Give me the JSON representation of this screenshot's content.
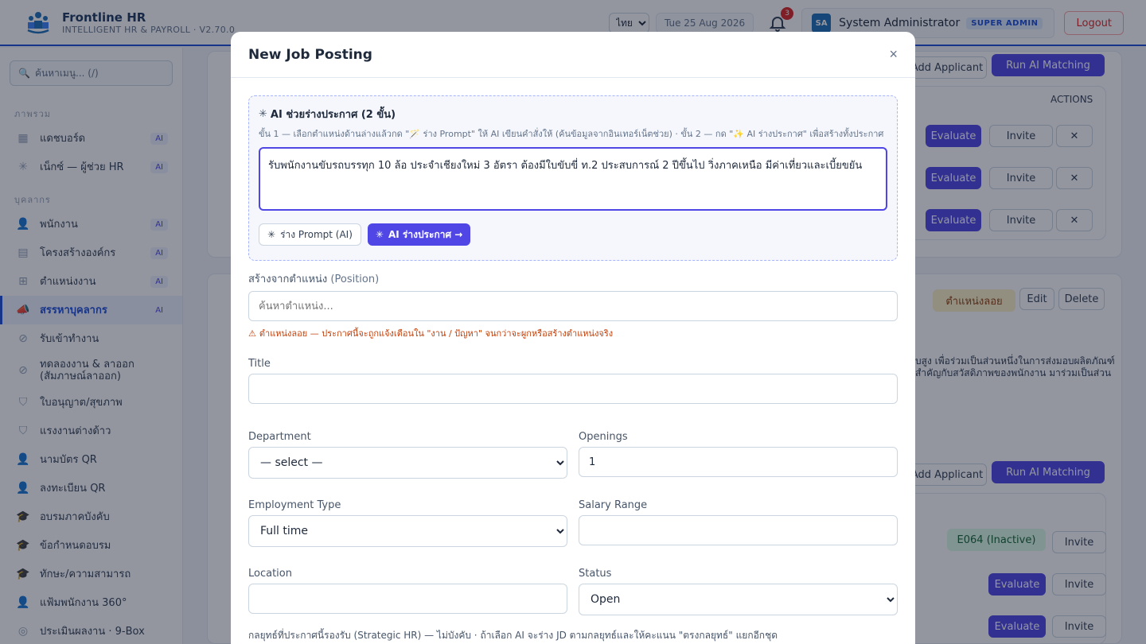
{
  "header": {
    "brand_name": "Frontline HR",
    "brand_sub": "INTELLIGENT HR & PAYROLL · V2.70.0",
    "lang": "ไทย",
    "date": "Tue 25 Aug 2026",
    "notif_count": "3",
    "avatar_initials": "SA",
    "user_name": "System Administrator",
    "role": "SUPER ADMIN",
    "logout_label": "Logout"
  },
  "sidebar": {
    "search_placeholder": "ค้นหาเมนู... (/)",
    "section_overview": "ภาพรวม",
    "section_people": "บุคลากร",
    "items": [
      {
        "label": "แดชบอร์ด",
        "icon": "dashboard-icon",
        "ai": "AI"
      },
      {
        "label": "เน็กซ์ — ผู้ช่วย HR",
        "icon": "sparkle-icon",
        "ai": "AI"
      },
      {
        "label": "พนักงาน",
        "icon": "users-icon",
        "ai": "AI"
      },
      {
        "label": "โครงสร้างองค์กร",
        "icon": "building-icon",
        "ai": "AI"
      },
      {
        "label": "ตำแหน่งงาน",
        "icon": "org-chart-icon",
        "ai": "AI"
      },
      {
        "label": "สรรหาบุคลากร",
        "icon": "megaphone-icon",
        "ai": "AI"
      },
      {
        "label": "รับเข้าทำงาน",
        "icon": "compass-icon",
        "ai": ""
      },
      {
        "label": "ทดลองงาน & ลาออก (สัมภาษณ์ลาออก)",
        "icon": "compass-icon",
        "ai": ""
      },
      {
        "label": "ใบอนุญาต/สุขภาพ",
        "icon": "shield-check-icon",
        "ai": ""
      },
      {
        "label": "แรงงานต่างด้าว",
        "icon": "shield-check-icon",
        "ai": ""
      },
      {
        "label": "นามบัตร QR",
        "icon": "user-icon",
        "ai": ""
      },
      {
        "label": "ลงทะเบียน QR",
        "icon": "user-icon",
        "ai": ""
      },
      {
        "label": "อบรมภาคบังคับ",
        "icon": "graduation-cap-icon",
        "ai": ""
      },
      {
        "label": "ข้อกำหนดอบรม",
        "icon": "graduation-cap-icon",
        "ai": ""
      },
      {
        "label": "ทักษะ/ความสามารถ",
        "icon": "graduation-cap-icon",
        "ai": ""
      },
      {
        "label": "แฟ้มพนักงาน 360°",
        "icon": "user-icon",
        "ai": ""
      },
      {
        "label": "ประเมินผลงาน · 9-Box",
        "icon": "target-icon",
        "ai": ""
      }
    ]
  },
  "background": {
    "add_applicant": "Add Applicant",
    "run_ai_matching": "Run AI Matching",
    "actions_header": "ACTIONS",
    "evaluate": "Evaluate",
    "invite": "Invite",
    "edit": "Edit",
    "delete": "Delete",
    "floating_position": "ตำแหน่งลอย",
    "inactive_badge": "E064 (Inactive)",
    "snippet_1": "บสูง เพื่อร่วมเป็นส่วนหนึ่งในการส่งมอบผลิตภัณฑ์",
    "snippet_2": "สำคัญกับสวัสดิภาพของพนักงาน มาร่วมเป็นส่วน"
  },
  "modal": {
    "title": "New Job Posting",
    "close": "×",
    "ai_box": {
      "title": "AI ช่วยร่างประกาศ (2 ขั้น)",
      "help": "ขั้น 1 — เลือกตำแหน่งด้านล่างแล้วกด \"🪄 ร่าง Prompt\" ให้ AI เขียนคำสั่งให้ (ค้นข้อมูลจากอินเทอร์เน็ตช่วย) · ขั้น 2 — กด \"✨ AI ร่างประกาศ\" เพื่อสร้างทั้งประกาศ",
      "prompt_text": "รับพนักงานขับรถบรรทุก 10 ล้อ ประจำเชียงใหม่ 3 อัตรา ต้องมีใบขับขี่ ท.2 ประสบการณ์ 2 ปีขึ้นไป วิ่งภาคเหนือ มีค่าเที่ยวและเบี้ยขยัน",
      "draft_prompt_btn": "ร่าง Prompt (AI)",
      "ai_draft_btn": "AI ร่างประกาศ →"
    },
    "position": {
      "label_th": "สร้างจากตำแหน่ง",
      "label_en": "(Position)",
      "placeholder": "ค้นหาตำแหน่ง...",
      "warning": "ตำแหน่งลอย — ประกาศนี้จะถูกแจ้งเตือนใน \"งาน / ปัญหา\" จนกว่าจะผูกหรือสร้างตำแหน่งจริง"
    },
    "title_field": {
      "label": "Title",
      "value": ""
    },
    "department": {
      "label": "Department",
      "value": "— select —"
    },
    "openings": {
      "label": "Openings",
      "value": "1"
    },
    "employment_type": {
      "label": "Employment Type",
      "value": "Full time"
    },
    "salary_range": {
      "label": "Salary Range",
      "value": ""
    },
    "location": {
      "label": "Location",
      "value": ""
    },
    "status": {
      "label": "Status",
      "value": "Open"
    },
    "strategic": "กลยุทธ์ที่ประกาศนี้รองรับ (Strategic HR) — ไม่บังคับ · ถ้าเลือก AI จะร่าง JD ตามกลยุทธ์และให้คะแนน \"ตรงกลยุทธ์\" แยกอีกชุด"
  }
}
